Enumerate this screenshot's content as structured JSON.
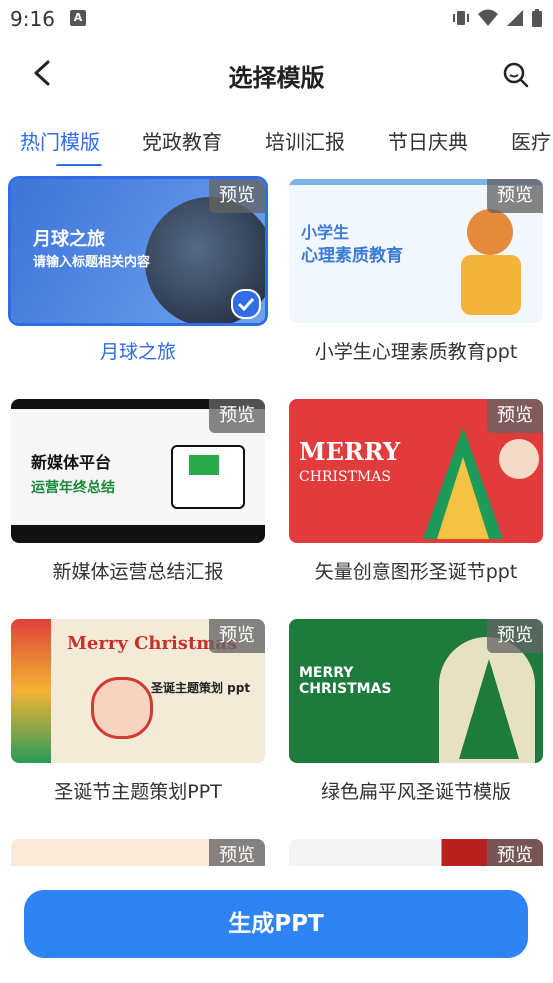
{
  "status": {
    "time": "9:16"
  },
  "header": {
    "title": "选择模版"
  },
  "tabs": [
    "热门模版",
    "党政教育",
    "培训汇报",
    "节日庆典",
    "医疗"
  ],
  "preview_label": "预览",
  "templates": [
    {
      "name": "月球之旅",
      "selected": true,
      "thumb_title": "月球之旅",
      "thumb_sub": "请输入标题相关内容"
    },
    {
      "name": "小学生心理素质教育ppt",
      "thumb_title": "小学生",
      "thumb_sub": "心理素质教育"
    },
    {
      "name": "新媒体运营总结汇报",
      "thumb_title": "新媒体平台",
      "thumb_sub": "运营年终总结"
    },
    {
      "name": "矢量创意图形圣诞节ppt",
      "thumb_title": "MERRY",
      "thumb_sub": "CHRISTMAS"
    },
    {
      "name": "圣诞节主题策划PPT",
      "thumb_title": "Merry Christmas",
      "thumb_sub": "圣诞主题策划 ppt"
    },
    {
      "name": "绿色扁平风圣诞节模版",
      "thumb_title": "MERRY",
      "thumb_sub": "CHRISTMAS"
    }
  ],
  "generate_button": "生成PPT",
  "colors": {
    "accent": "#2f6ce6",
    "button": "#2f84f3"
  }
}
